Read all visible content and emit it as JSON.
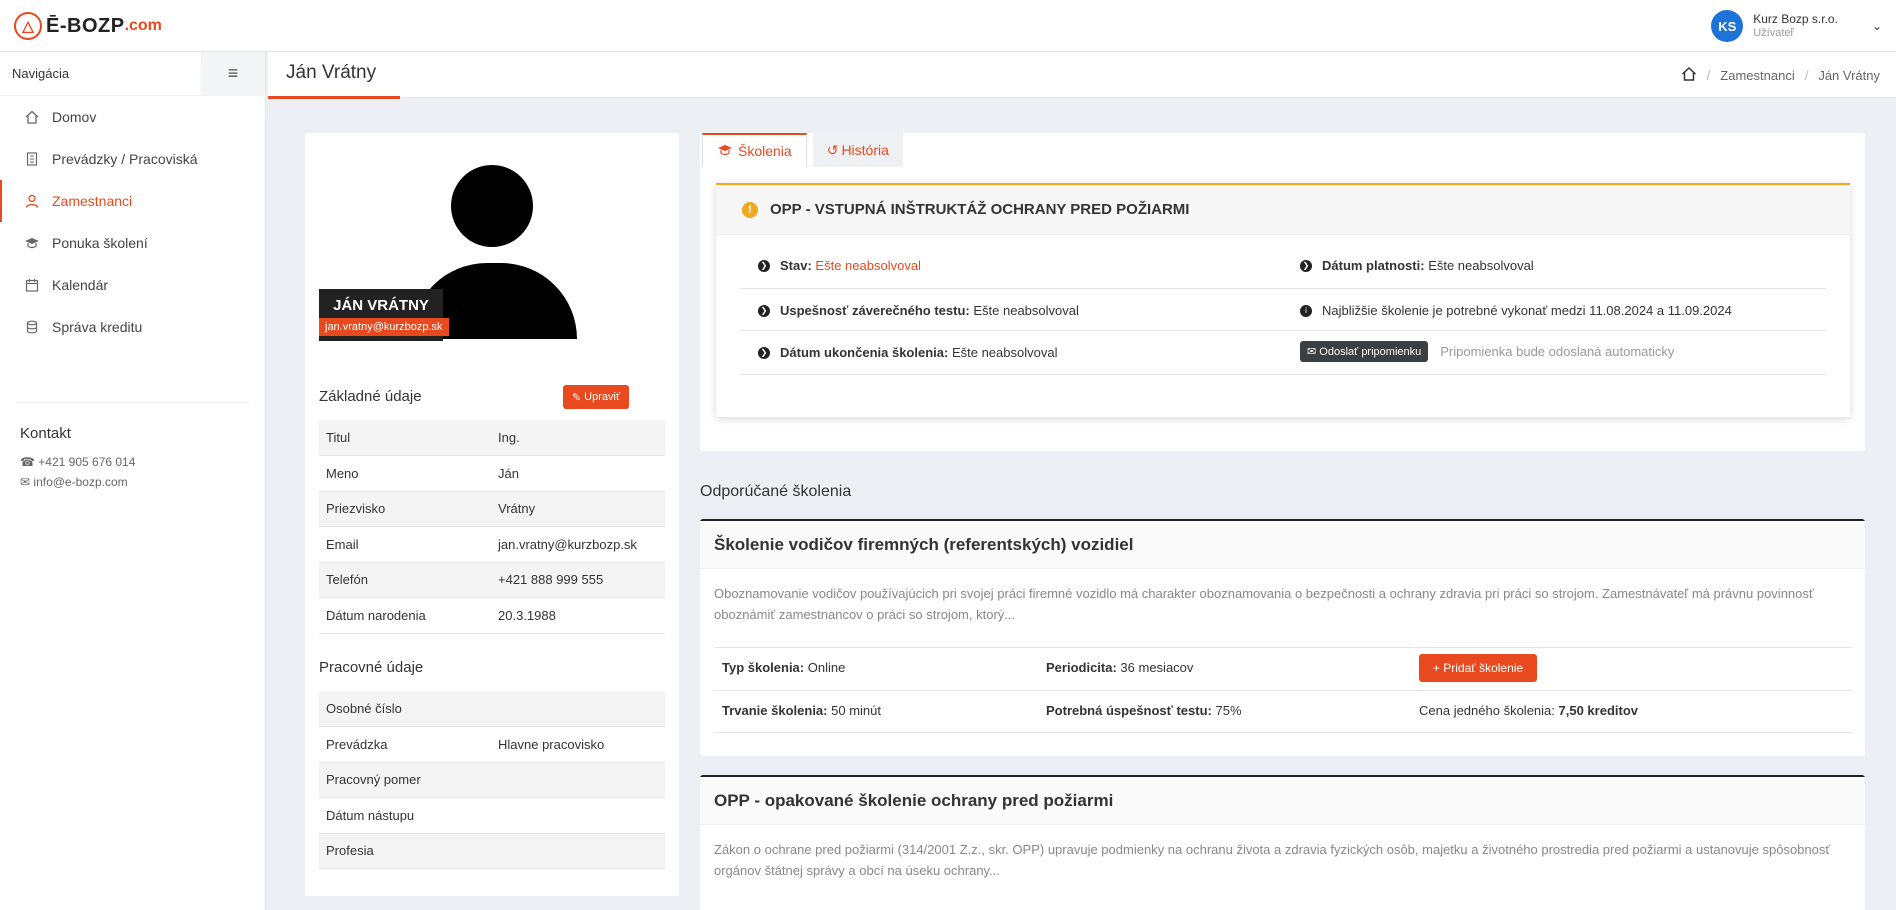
{
  "app": {
    "logo_mark": "Ē",
    "logo_text": "Ē-BOZP",
    "logo_domain": ".com"
  },
  "user": {
    "initials": "KS",
    "name": "Kurz Bozp s.r.o.",
    "role": "Užívateľ"
  },
  "sidebar": {
    "title": "Navigácia",
    "items": [
      {
        "label": "Domov",
        "icon": "home-icon"
      },
      {
        "label": "Prevádzky / Pracoviská",
        "icon": "building-icon"
      },
      {
        "label": "Zamestnanci",
        "icon": "user-icon"
      },
      {
        "label": "Ponuka školení",
        "icon": "graduation-cap-icon"
      },
      {
        "label": "Kalendár",
        "icon": "calendar-icon"
      },
      {
        "label": "Správa kreditu",
        "icon": "coins-icon"
      }
    ],
    "active_index": 2,
    "contact_title": "Kontakt",
    "phone": "+421 905 676 014",
    "email": "info@e-bozp.com"
  },
  "page": {
    "title": "Ján Vrátny",
    "breadcrumb": [
      "Zamestnanci",
      "Ján Vrátny"
    ]
  },
  "profile": {
    "name": "JÁN VRÁTNY",
    "email": "jan.vratny@kurzbozp.sk",
    "basic_title": "Základné údaje",
    "edit_label": "Upraviť",
    "basic": [
      {
        "label": "Titul",
        "value": "Ing."
      },
      {
        "label": "Meno",
        "value": "Ján"
      },
      {
        "label": "Priezvisko",
        "value": "Vrátny"
      },
      {
        "label": "Email",
        "value": "jan.vratny@kurzbozp.sk"
      },
      {
        "label": "Telefón",
        "value": "+421 888 999 555"
      },
      {
        "label": "Dátum narodenia",
        "value": "20.3.1988"
      }
    ],
    "work_title": "Pracovné údaje",
    "work": [
      {
        "label": "Osobné číslo",
        "value": ""
      },
      {
        "label": "Prevádzka",
        "value": "Hlavne pracovisko"
      },
      {
        "label": "Pracovný pomer",
        "value": ""
      },
      {
        "label": "Dátum nástupu",
        "value": ""
      },
      {
        "label": "Profesia",
        "value": ""
      }
    ]
  },
  "tabs": {
    "trainings": "Školenia",
    "history": "História"
  },
  "opp": {
    "title": "OPP - VSTUPNÁ INŠTRUKTÁŽ OCHRANY PRED POŽIARMI",
    "stav_label": "Stav:",
    "stav_value": "Ešte neabsolvoval",
    "platnost_label": "Dátum platnosti:",
    "platnost_value": "Ešte neabsolvoval",
    "test_label": "Uspešnosť záverečného testu:",
    "test_value": "Ešte neabsolvoval",
    "next_info": "Najbližšie školenie je potrebné vykonať medzi 11.08.2024 a 11.09.2024",
    "end_label": "Dátum ukončenia školenia:",
    "end_value": "Ešte neabsolvoval",
    "remind_label": "Odoslať pripomienku",
    "remind_note": "Pripomienka bude odoslaná automaticky"
  },
  "recommended": {
    "title": "Odporúčané školenia",
    "courses": [
      {
        "title": "Školenie vodičov firemných (referentských) vozidiel",
        "description": "Oboznamovanie vodičov používajúcich pri svojej práci firemné vozidlo má charakter oboznamovania o bezpečnosti a ochrany zdravia pri práci so strojom. Zamestnávateľ má právnu povinnosť oboznámiť zamestnancov o práci so strojom, ktorý...",
        "type_label": "Typ školenia:",
        "type_value": "Online",
        "period_label": "Periodicita:",
        "period_value": "36 mesiacov",
        "add_label": "Pridať školenie",
        "duration_label": "Trvanie školenia:",
        "duration_value": "50 minút",
        "pass_label": "Potrebná úspešnosť testu:",
        "pass_value": "75%",
        "price_label": "Cena jedného školenia:",
        "price_value": "7,50 kreditov"
      },
      {
        "title": "OPP - opakované školenie ochrany pred požiarmi",
        "description": "Zákon o ochrane pred požiarmi (314/2001 Z.z., skr. OPP) upravuje podmienky na ochranu života a zdravia fyzických osôb, majetku a životného prostredia pred požiarmi a ustanovuje spôsobnosť orgánov štátnej správy a obcí na úseku ochrany..."
      }
    ]
  },
  "colors": {
    "accent": "#e8491e",
    "warning": "#f0a81f",
    "avatar": "#1e73d8"
  }
}
